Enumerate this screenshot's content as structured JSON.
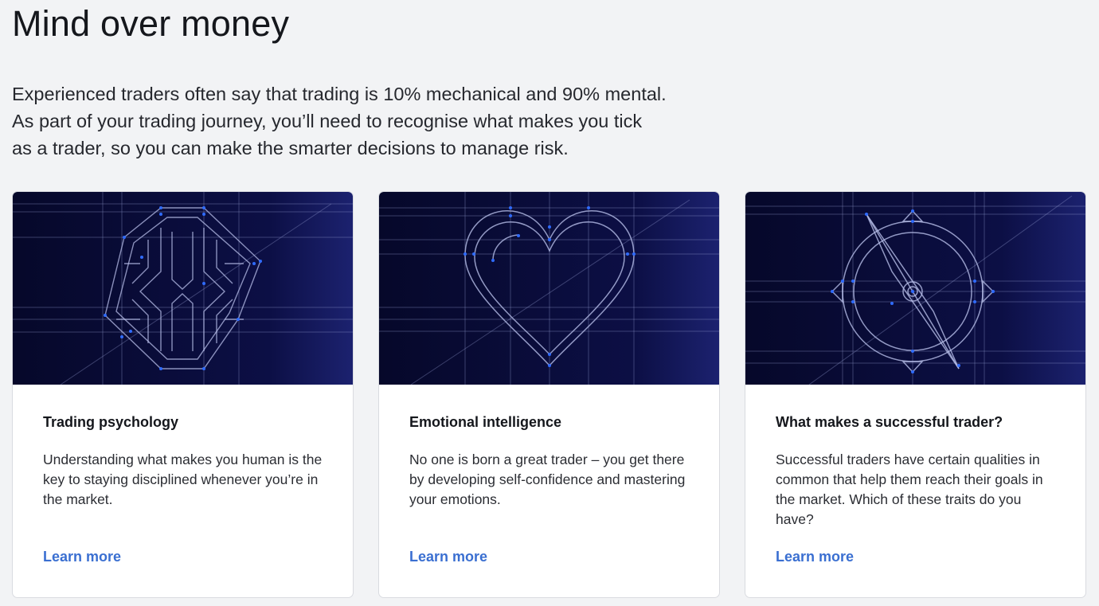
{
  "heading": "Mind over money",
  "intro": {
    "line1": "Experienced traders often say that trading is 10% mechanical and 90% mental.",
    "line2": "As part of your trading journey, you’ll need to recognise what makes you tick",
    "line3": "as a trader, so you can make the smarter decisions to manage risk."
  },
  "cards": [
    {
      "title": "Trading psychology",
      "text": "Understanding what makes you human is the key to staying disciplined whenever you’re in the market.",
      "link": "Learn more",
      "icon": "brain-maze-icon"
    },
    {
      "title": "Emotional intelligence",
      "text": "No one is born a great trader – you get there by developing self-confidence and mastering your emotions.",
      "link": "Learn more",
      "icon": "heart-icon"
    },
    {
      "title": "What makes a successful trader?",
      "text": "Successful traders have certain qualities in common that help them reach their goals in the market. Which of these traits do you have?",
      "link": "Learn more",
      "icon": "compass-icon"
    }
  ],
  "colors": {
    "page_background": "#f2f3f5",
    "card_image_dark": "#07092e",
    "card_image_light": "#1a1f66",
    "link": "#3a6fd1",
    "node_dot": "#2f6bff"
  }
}
